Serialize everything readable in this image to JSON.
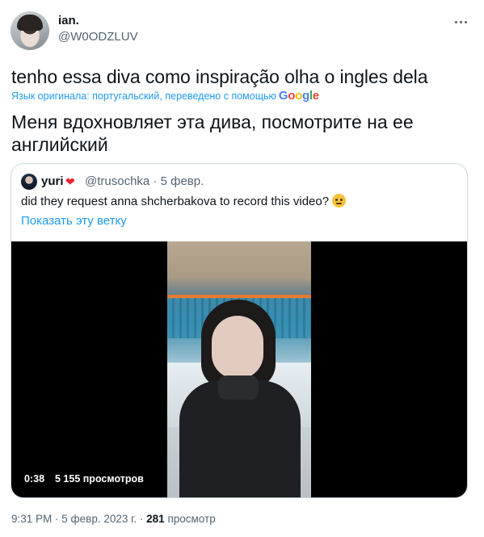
{
  "author": {
    "display_name": "ian.",
    "handle": "@W0ODZLUV",
    "avatar_icon": "profile-photo"
  },
  "tweet": {
    "original_text": "tenho essa diva como inspiração olha o ingles dela",
    "translation_note": "Язык оригинала: португальский, переведено с помощью",
    "translator_logo": "Google",
    "translated_text": "Меня вдохновляет эта дива, посмотрите на ее английский"
  },
  "quoted": {
    "display_name": "yuri",
    "badge_icon": "heart-emoji",
    "meta": "@trusochka · 5 февр.",
    "text": "did they request anna shcherbakova to record this video?",
    "emoji_icon": "face-with-raised-eyebrow-emoji",
    "show_thread": "Показать эту ветку",
    "video": {
      "time": "0:38",
      "views": "5 155 просмотров"
    }
  },
  "footer": {
    "time": "9:31 PM",
    "date": "5 февр. 2023 г.",
    "views_count": "281",
    "views_label": "просмотр"
  },
  "colors": {
    "accent": "#1d9bf0",
    "text_primary": "#0f1419",
    "text_secondary": "#536471",
    "border": "#cfd9de"
  }
}
